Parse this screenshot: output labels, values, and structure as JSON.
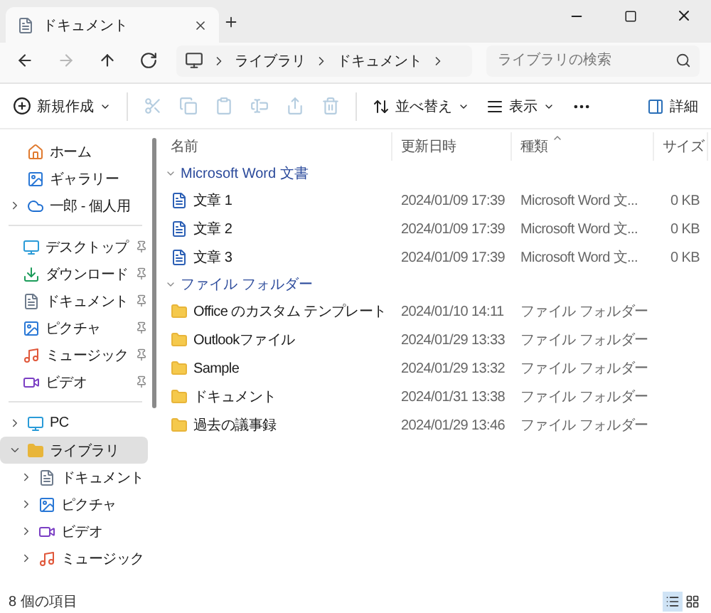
{
  "window": {
    "tab": {
      "title": "ドキュメント",
      "selected": true
    }
  },
  "nav": {
    "buttons": [
      {
        "disabled": false
      },
      {
        "disabled": true
      },
      {
        "disabled": false
      },
      {
        "disabled": false
      }
    ],
    "breadcrumb": [
      "ライブラリ",
      "ドキュメント"
    ],
    "search": {
      "placeholder": "ライブラリの検索"
    }
  },
  "toolbar": {
    "new": {
      "label": "新規作成"
    },
    "actions": [
      {
        "disabled": true
      },
      {
        "disabled": true
      },
      {
        "disabled": true
      },
      {
        "disabled": true
      },
      {
        "disabled": true
      },
      {
        "disabled": true
      }
    ],
    "sort": {
      "label": "並べ替え"
    },
    "view": {
      "label": "表示"
    },
    "details": {
      "label": "詳細"
    }
  },
  "sidebar": {
    "sections": [
      {
        "items": [
          {
            "label": "ホーム"
          },
          {
            "label": "ギャラリー"
          },
          {
            "label": "一郎 - 個人用",
            "expanded": false
          }
        ]
      },
      {
        "items": [
          {
            "label": "デスクトップ",
            "pinned": true
          },
          {
            "label": "ダウンロード",
            "pinned": true
          },
          {
            "label": "ドキュメント",
            "pinned": true
          },
          {
            "label": "ピクチャ",
            "pinned": true
          },
          {
            "label": "ミュージック",
            "pinned": true
          },
          {
            "label": "ビデオ",
            "pinned": true
          }
        ]
      },
      {
        "items": [
          {
            "label": "PC",
            "expanded": false,
            "selected": false
          },
          {
            "label": "ライブラリ",
            "expanded": true,
            "selected": true,
            "children": [
              {
                "label": "ドキュメント",
                "expanded": false,
                "selected": false
              },
              {
                "label": "ピクチャ",
                "expanded": false,
                "selected": false
              },
              {
                "label": "ビデオ",
                "expanded": false,
                "selected": false
              },
              {
                "label": "ミュージック",
                "expanded": false,
                "selected": false
              }
            ]
          }
        ]
      }
    ]
  },
  "table": {
    "columns": [
      {
        "label": "名前",
        "sorted": false
      },
      {
        "label": "更新日時",
        "sorted": false
      },
      {
        "label": "種類",
        "sorted": true
      },
      {
        "label": "サイズ",
        "sorted": false
      }
    ],
    "groups": [
      {
        "label": "Microsoft Word 文書",
        "kind": "word",
        "expanded": true,
        "rows": [
          {
            "name": "文章 1",
            "date": "2024/01/09 17:39",
            "type": "Microsoft Word 文...",
            "size": "0 KB"
          },
          {
            "name": "文章 2",
            "date": "2024/01/09 17:39",
            "type": "Microsoft Word 文...",
            "size": "0 KB"
          },
          {
            "name": "文章 3",
            "date": "2024/01/09 17:39",
            "type": "Microsoft Word 文...",
            "size": "0 KB"
          }
        ]
      },
      {
        "label": "ファイル フォルダー",
        "kind": "folder",
        "expanded": true,
        "rows": [
          {
            "name": "Office のカスタム テンプレート",
            "date": "2024/01/10 14:11",
            "type": "ファイル フォルダー"
          },
          {
            "name": "Outlookファイル",
            "date": "2024/01/29 13:33",
            "type": "ファイル フォルダー"
          },
          {
            "name": "Sample",
            "date": "2024/01/29 13:32",
            "type": "ファイル フォルダー"
          },
          {
            "name": "ドキュメント",
            "date": "2024/01/31 13:38",
            "type": "ファイル フォルダー"
          },
          {
            "name": "過去の議事録",
            "date": "2024/01/29 13:46",
            "type": "ファイル フォルダー"
          }
        ]
      }
    ]
  },
  "status_bar": {
    "text": "8 個の項目",
    "views": [
      {
        "selected": true
      },
      {
        "selected": false
      }
    ]
  }
}
